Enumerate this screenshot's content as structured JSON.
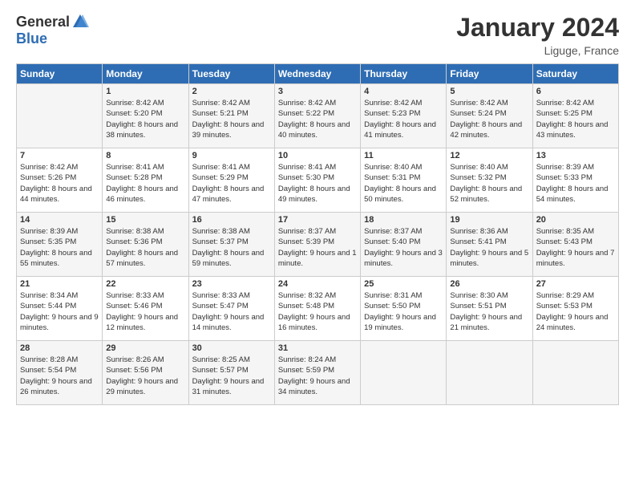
{
  "header": {
    "logo_general": "General",
    "logo_blue": "Blue",
    "month_title": "January 2024",
    "location": "Liguge, France"
  },
  "columns": [
    "Sunday",
    "Monday",
    "Tuesday",
    "Wednesday",
    "Thursday",
    "Friday",
    "Saturday"
  ],
  "weeks": [
    [
      {
        "day": "",
        "sunrise": "",
        "sunset": "",
        "daylight": ""
      },
      {
        "day": "1",
        "sunrise": "Sunrise: 8:42 AM",
        "sunset": "Sunset: 5:20 PM",
        "daylight": "Daylight: 8 hours and 38 minutes."
      },
      {
        "day": "2",
        "sunrise": "Sunrise: 8:42 AM",
        "sunset": "Sunset: 5:21 PM",
        "daylight": "Daylight: 8 hours and 39 minutes."
      },
      {
        "day": "3",
        "sunrise": "Sunrise: 8:42 AM",
        "sunset": "Sunset: 5:22 PM",
        "daylight": "Daylight: 8 hours and 40 minutes."
      },
      {
        "day": "4",
        "sunrise": "Sunrise: 8:42 AM",
        "sunset": "Sunset: 5:23 PM",
        "daylight": "Daylight: 8 hours and 41 minutes."
      },
      {
        "day": "5",
        "sunrise": "Sunrise: 8:42 AM",
        "sunset": "Sunset: 5:24 PM",
        "daylight": "Daylight: 8 hours and 42 minutes."
      },
      {
        "day": "6",
        "sunrise": "Sunrise: 8:42 AM",
        "sunset": "Sunset: 5:25 PM",
        "daylight": "Daylight: 8 hours and 43 minutes."
      }
    ],
    [
      {
        "day": "7",
        "sunrise": "Sunrise: 8:42 AM",
        "sunset": "Sunset: 5:26 PM",
        "daylight": "Daylight: 8 hours and 44 minutes."
      },
      {
        "day": "8",
        "sunrise": "Sunrise: 8:41 AM",
        "sunset": "Sunset: 5:28 PM",
        "daylight": "Daylight: 8 hours and 46 minutes."
      },
      {
        "day": "9",
        "sunrise": "Sunrise: 8:41 AM",
        "sunset": "Sunset: 5:29 PM",
        "daylight": "Daylight: 8 hours and 47 minutes."
      },
      {
        "day": "10",
        "sunrise": "Sunrise: 8:41 AM",
        "sunset": "Sunset: 5:30 PM",
        "daylight": "Daylight: 8 hours and 49 minutes."
      },
      {
        "day": "11",
        "sunrise": "Sunrise: 8:40 AM",
        "sunset": "Sunset: 5:31 PM",
        "daylight": "Daylight: 8 hours and 50 minutes."
      },
      {
        "day": "12",
        "sunrise": "Sunrise: 8:40 AM",
        "sunset": "Sunset: 5:32 PM",
        "daylight": "Daylight: 8 hours and 52 minutes."
      },
      {
        "day": "13",
        "sunrise": "Sunrise: 8:39 AM",
        "sunset": "Sunset: 5:33 PM",
        "daylight": "Daylight: 8 hours and 54 minutes."
      }
    ],
    [
      {
        "day": "14",
        "sunrise": "Sunrise: 8:39 AM",
        "sunset": "Sunset: 5:35 PM",
        "daylight": "Daylight: 8 hours and 55 minutes."
      },
      {
        "day": "15",
        "sunrise": "Sunrise: 8:38 AM",
        "sunset": "Sunset: 5:36 PM",
        "daylight": "Daylight: 8 hours and 57 minutes."
      },
      {
        "day": "16",
        "sunrise": "Sunrise: 8:38 AM",
        "sunset": "Sunset: 5:37 PM",
        "daylight": "Daylight: 8 hours and 59 minutes."
      },
      {
        "day": "17",
        "sunrise": "Sunrise: 8:37 AM",
        "sunset": "Sunset: 5:39 PM",
        "daylight": "Daylight: 9 hours and 1 minute."
      },
      {
        "day": "18",
        "sunrise": "Sunrise: 8:37 AM",
        "sunset": "Sunset: 5:40 PM",
        "daylight": "Daylight: 9 hours and 3 minutes."
      },
      {
        "day": "19",
        "sunrise": "Sunrise: 8:36 AM",
        "sunset": "Sunset: 5:41 PM",
        "daylight": "Daylight: 9 hours and 5 minutes."
      },
      {
        "day": "20",
        "sunrise": "Sunrise: 8:35 AM",
        "sunset": "Sunset: 5:43 PM",
        "daylight": "Daylight: 9 hours and 7 minutes."
      }
    ],
    [
      {
        "day": "21",
        "sunrise": "Sunrise: 8:34 AM",
        "sunset": "Sunset: 5:44 PM",
        "daylight": "Daylight: 9 hours and 9 minutes."
      },
      {
        "day": "22",
        "sunrise": "Sunrise: 8:33 AM",
        "sunset": "Sunset: 5:46 PM",
        "daylight": "Daylight: 9 hours and 12 minutes."
      },
      {
        "day": "23",
        "sunrise": "Sunrise: 8:33 AM",
        "sunset": "Sunset: 5:47 PM",
        "daylight": "Daylight: 9 hours and 14 minutes."
      },
      {
        "day": "24",
        "sunrise": "Sunrise: 8:32 AM",
        "sunset": "Sunset: 5:48 PM",
        "daylight": "Daylight: 9 hours and 16 minutes."
      },
      {
        "day": "25",
        "sunrise": "Sunrise: 8:31 AM",
        "sunset": "Sunset: 5:50 PM",
        "daylight": "Daylight: 9 hours and 19 minutes."
      },
      {
        "day": "26",
        "sunrise": "Sunrise: 8:30 AM",
        "sunset": "Sunset: 5:51 PM",
        "daylight": "Daylight: 9 hours and 21 minutes."
      },
      {
        "day": "27",
        "sunrise": "Sunrise: 8:29 AM",
        "sunset": "Sunset: 5:53 PM",
        "daylight": "Daylight: 9 hours and 24 minutes."
      }
    ],
    [
      {
        "day": "28",
        "sunrise": "Sunrise: 8:28 AM",
        "sunset": "Sunset: 5:54 PM",
        "daylight": "Daylight: 9 hours and 26 minutes."
      },
      {
        "day": "29",
        "sunrise": "Sunrise: 8:26 AM",
        "sunset": "Sunset: 5:56 PM",
        "daylight": "Daylight: 9 hours and 29 minutes."
      },
      {
        "day": "30",
        "sunrise": "Sunrise: 8:25 AM",
        "sunset": "Sunset: 5:57 PM",
        "daylight": "Daylight: 9 hours and 31 minutes."
      },
      {
        "day": "31",
        "sunrise": "Sunrise: 8:24 AM",
        "sunset": "Sunset: 5:59 PM",
        "daylight": "Daylight: 9 hours and 34 minutes."
      },
      {
        "day": "",
        "sunrise": "",
        "sunset": "",
        "daylight": ""
      },
      {
        "day": "",
        "sunrise": "",
        "sunset": "",
        "daylight": ""
      },
      {
        "day": "",
        "sunrise": "",
        "sunset": "",
        "daylight": ""
      }
    ]
  ]
}
